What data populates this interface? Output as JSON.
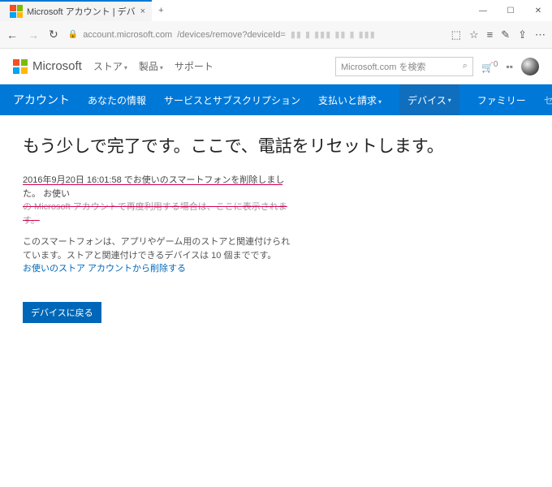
{
  "window": {
    "tab_title": "Microsoft アカウント | デバ",
    "url_host": "account.microsoft.com",
    "url_path": "/devices/remove?deviceId="
  },
  "ms_header": {
    "brand": "Microsoft",
    "nav": {
      "store": "ストア",
      "products": "製品",
      "support": "サポート"
    },
    "search_placeholder": "Microsoft.com を検索",
    "cart_count": "0"
  },
  "blue_nav": {
    "account": "アカウント",
    "your_info": "あなたの情報",
    "services": "サービスとサブスクリプション",
    "billing": "支払いと請求",
    "devices": "デバイス",
    "family": "ファミリー",
    "security": "セキュリティとプライ"
  },
  "page": {
    "heading": "もう少しで完了です。ここで、電話をリセットします。",
    "removed_line": "2016年9月20日 16:01:58 でお使いのスマートフォンを削除しました。",
    "removed_tail": "お使い",
    "removed_struck": "の Microsoft アカウントで再度利用する場合は、ここに表示されます。",
    "body": "このスマートフォンは、アプリやゲーム用のストアと関連付けられています。ストアと関連付けできるデバイスは 10 個までです。",
    "link": "お使いのストア アカウントから削除する",
    "back_button": "デバイスに戻る"
  }
}
